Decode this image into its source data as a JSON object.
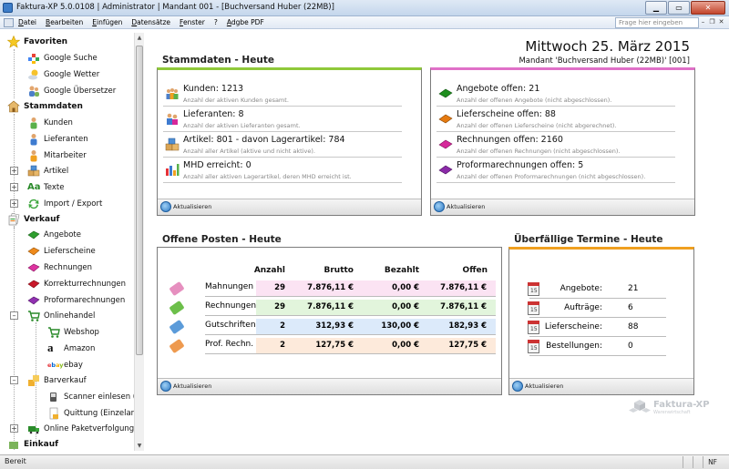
{
  "window": {
    "title": "Faktura-XP 5.0.0108 | Administrator | Mandant 001 - [Buchversand Huber (22MB)]"
  },
  "menu": {
    "items": [
      "Datei",
      "Bearbeiten",
      "Einfügen",
      "Datensätze",
      "Fenster",
      "?",
      "Adgbe PDF"
    ],
    "help_placeholder": "Frage hier eingeben"
  },
  "sidebar": {
    "favoriten": {
      "label": "Favoriten",
      "items": [
        "Google Suche",
        "Google Wetter",
        "Google Übersetzer"
      ]
    },
    "stammdaten": {
      "label": "Stammdaten",
      "items": [
        "Kunden",
        "Lieferanten",
        "Mitarbeiter",
        "Artikel",
        "Texte",
        "Import / Export"
      ]
    },
    "verkauf": {
      "label": "Verkauf",
      "items": [
        "Angebote",
        "Lieferscheine",
        "Rechnungen",
        "Korrekturrechnungen",
        "Proformarechnungen",
        "Onlinehandel",
        "Webshop",
        "Amazon",
        "ebay",
        "Barverkauf",
        "Scanner einlesen (Bar",
        "Quittung (Einzelartikel)",
        "Online Paketverfolgung"
      ]
    },
    "einkauf": {
      "label": "Einkauf"
    }
  },
  "header": {
    "date": "Mittwoch 25. März 2015",
    "mandant": "Mandant 'Buchversand Huber (22MB)' [001]"
  },
  "stammdaten_panel": {
    "title": "Stammdaten - Heute",
    "refresh": "Aktualisieren",
    "stats": [
      {
        "main": "Kunden: 1213",
        "sub": "Anzahl der aktiven Kunden gesamt."
      },
      {
        "main": "Lieferanten: 8",
        "sub": "Anzahl der aktiven Lieferanten gesamt."
      },
      {
        "main": "Artikel: 801 - davon Lagerartikel: 784",
        "sub": "Anzahl aller Artikel (aktive und nicht aktive)."
      },
      {
        "main": "MHD erreicht: 0",
        "sub": "Anzahl aller aktiven Lagerartikel, deren MHD erreicht ist."
      }
    ]
  },
  "verkauf_panel": {
    "refresh": "Aktualisieren",
    "stats": [
      {
        "main": "Angebote offen: 21",
        "sub": "Anzahl der offenen Angebote (nicht abgeschlossen).",
        "color": "#1f8f1f"
      },
      {
        "main": "Lieferscheine offen: 88",
        "sub": "Anzahl der offenen Lieferscheine (nicht abgerechnet).",
        "color": "#e57a10"
      },
      {
        "main": "Rechnungen offen: 2160",
        "sub": "Anzahl der offenen Rechnungen (nicht abgeschlossen).",
        "color": "#d6289a"
      },
      {
        "main": "Proformarechnungen offen: 5",
        "sub": "Anzahl der offenen Proformarechnungen (nicht abgeschlossen).",
        "color": "#8a2aa8"
      }
    ]
  },
  "offene_posten": {
    "title": "Offene Posten - Heute",
    "refresh": "Aktualisieren",
    "headers": [
      "Anzahl",
      "Brutto",
      "Bezahlt",
      "Offen"
    ],
    "rows": [
      {
        "name": "Mahnungen",
        "anzahl": "29",
        "brutto": "7.876,11 €",
        "bezahlt": "0,00 €",
        "offen": "7.876,11 €",
        "bg": "#fbe3f3",
        "tag": "#e68fbf"
      },
      {
        "name": "Rechnungen",
        "anzahl": "29",
        "brutto": "7.876,11 €",
        "bezahlt": "0,00 €",
        "offen": "7.876,11 €",
        "bg": "#e2f5dc",
        "tag": "#6cbf4a"
      },
      {
        "name": "Gutschriften",
        "anzahl": "2",
        "brutto": "312,93 €",
        "bezahlt": "130,00 €",
        "offen": "182,93 €",
        "bg": "#dceafa",
        "tag": "#5b9bd9"
      },
      {
        "name": "Prof. Rechn.",
        "anzahl": "2",
        "brutto": "127,75 €",
        "bezahlt": "0,00 €",
        "offen": "127,75 €",
        "bg": "#fdeadb",
        "tag": "#ee9a4f"
      }
    ]
  },
  "termine": {
    "title": "Überfällige Termine - Heute",
    "refresh": "Aktualisieren",
    "calendar_day": "15",
    "rows": [
      {
        "label": "Angebote:",
        "value": "21"
      },
      {
        "label": "Aufträge:",
        "value": "6"
      },
      {
        "label": "Lieferscheine:",
        "value": "88"
      },
      {
        "label": "Bestellungen:",
        "value": "0"
      }
    ]
  },
  "logo": {
    "name": "Faktura-XP",
    "sub": "Warenwirtschaft"
  },
  "status": {
    "text": "Bereit",
    "cells": [
      "NF"
    ]
  }
}
